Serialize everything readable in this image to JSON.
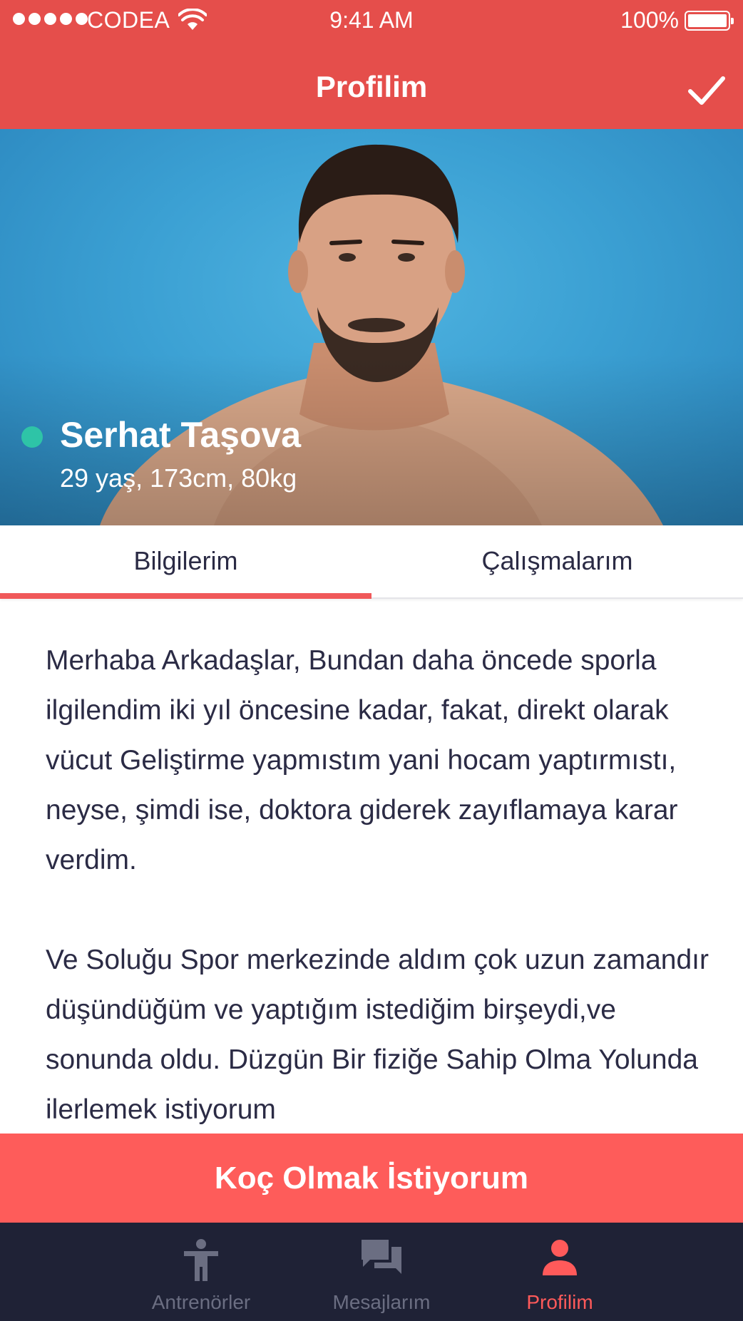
{
  "status_bar": {
    "carrier": "CODEA",
    "time": "9:41 AM",
    "battery": "100%"
  },
  "nav": {
    "title": "Profilim",
    "confirm_icon": "checkmark-icon"
  },
  "profile": {
    "name": "Serhat Taşova",
    "stats": "29 yaş, 173cm, 80kg",
    "online_color": "#2ec4a7"
  },
  "tabs": [
    {
      "label": "Bilgilerim",
      "active": true
    },
    {
      "label": "Çalışmalarım",
      "active": false
    }
  ],
  "bio": {
    "paragraph_1": "Merhaba Arkadaşlar, Bundan daha öncede sporla ilgilendim iki yıl öncesine kadar, fakat, direkt olarak vücut Geliştirme yapmıstım yani hocam yaptırmıstı, neyse, şimdi ise, doktora giderek zayıflamaya karar verdim.",
    "paragraph_2": "Ve Soluğu Spor merkezinde aldım çok uzun zamandır düşündüğüm ve yaptığım istediğim birşeydi,ve sonunda oldu. Düzgün Bir fiziğe Sahip Olma Yolunda ilerlemek istiyorum"
  },
  "cta": {
    "label": "Koç Olmak İstiyorum"
  },
  "tab_bar": {
    "items": [
      {
        "label": "Antrenörler",
        "icon": "person-figure-icon",
        "active": false
      },
      {
        "label": "Mesajlarım",
        "icon": "chat-bubbles-icon",
        "active": false
      },
      {
        "label": "Profilim",
        "icon": "user-profile-icon",
        "active": true
      }
    ]
  },
  "colors": {
    "header": "#e54e4b",
    "accent": "#fe5c5a",
    "tab_bar_bg": "#1f2236",
    "text": "#2b2b45"
  }
}
